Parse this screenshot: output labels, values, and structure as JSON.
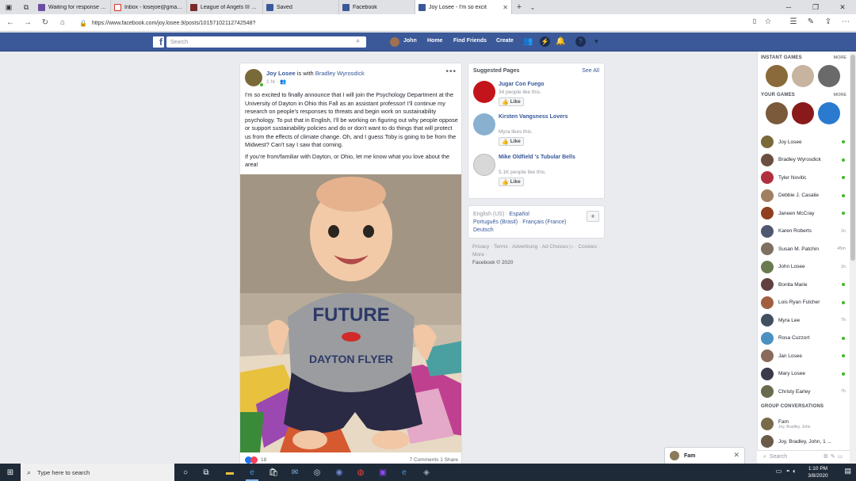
{
  "browser": {
    "tabs": [
      {
        "label": "Waiting for response from r",
        "color": "#6a4fa0"
      },
      {
        "label": "Inbox - losejoe@gmail.com",
        "color": "#d93025"
      },
      {
        "label": "League of Angels III on Face",
        "color": "#7a2a2a"
      },
      {
        "label": "Saved",
        "color": "#3b5998"
      },
      {
        "label": "Facebook",
        "color": "#3b5998"
      },
      {
        "label": "Joy Losee - I'm so excit",
        "color": "#3b5998"
      }
    ],
    "url": "https://www.facebook.com/joy.losee.9/posts/10157102112742548?"
  },
  "header": {
    "search_placeholder": "Search",
    "user": "John",
    "home": "Home",
    "find_friends": "Find Friends",
    "create": "Create"
  },
  "post": {
    "author": "Joy Losee",
    "with_text": "is with",
    "with_name": "Bradley Wyrosdick",
    "time": "1 hr · ",
    "body1": "I'm so excited to finally announce that I will join the Psychology Department at the University of Dayton in Ohio this Fall as an assistant professor! I'll continue my research on people's responses to threats and begin work on sustainability psychology. To put that in English, I'll be working on figuring out why people oppose or support sustainability policies and do or don't want to do things that will protect us from the effects of climate change. Oh, and I guess Toby is going to be from the Midwest? Can't say I saw that coming.",
    "body2": "If you're from/familiar with Dayton, or Ohio, let me know what you love about the area!",
    "shirt_line1": "FUTURE",
    "shirt_line2": "DAYTON FLYER",
    "reaction_count": "18",
    "comments": "7 Comments  1 Share"
  },
  "suggested": {
    "title": "Suggested Pages",
    "see_all": "See All",
    "like_label": "Like",
    "pages": [
      {
        "name": "Jugar Con Fuego",
        "likes": "34 people like this.",
        "color": "#c4141b"
      },
      {
        "name": "Kirsten Vangsness Lovers",
        "likes": "Myra likes this.",
        "color": "#8ab0d0"
      },
      {
        "name": "Mike Oldfield 's Tubular Bells",
        "likes": "5.1K people like this.",
        "color": "#d8d8d8"
      }
    ]
  },
  "languages": {
    "current": "English (US)",
    "sep": " · ",
    "l1": "Español",
    "l2": "Português (Brasil)",
    "l3": "Français (France)",
    "l4": "Deutsch"
  },
  "footer": {
    "links": "Privacy · Terms · Advertising · Ad Choices ▷ · Cookies · More ·",
    "copyright": "Facebook © 2020"
  },
  "chat": {
    "instant_games": "INSTANT GAMES",
    "your_games": "YOUR GAMES",
    "more": "MORE",
    "group_conv": "GROUP CONVERSATIONS",
    "search_placeholder": "Search",
    "contacts": [
      {
        "name": "Joy Losee",
        "status": "",
        "color": "#7a6a3a"
      },
      {
        "name": "Bradley Wyrosdick",
        "status": "",
        "color": "#6a5040"
      },
      {
        "name": "Tyler Novitic",
        "status": "",
        "color": "#b03040"
      },
      {
        "name": "Debbie J. Casalie",
        "status": "",
        "color": "#a08060"
      },
      {
        "name": "Janeen McCray",
        "status": "",
        "color": "#904020"
      },
      {
        "name": "Karen Roberts",
        "status": "1h",
        "color": "#505870"
      },
      {
        "name": "Susan M. Patchin",
        "status": "45m",
        "color": "#807060"
      },
      {
        "name": "John Losee",
        "status": "1h",
        "color": "#6a7a50"
      },
      {
        "name": "Bonita Marie",
        "status": "",
        "color": "#604040"
      },
      {
        "name": "Lois Ryan Fulcher",
        "status": "",
        "color": "#a06040"
      },
      {
        "name": "Myra Lee",
        "status": "7h",
        "color": "#405060"
      },
      {
        "name": "Rosa Cuzzort",
        "status": "",
        "color": "#4a90c0"
      },
      {
        "name": "Jan Losee",
        "status": "",
        "color": "#8a6a5a"
      },
      {
        "name": "Mary Losee",
        "status": "",
        "color": "#3a3a4a"
      },
      {
        "name": "Christy Earley",
        "status": "7h",
        "color": "#6a6a50"
      }
    ],
    "groups": [
      {
        "name": "Fam",
        "sub": "Joy, Bradley, John"
      },
      {
        "name": "Joy, Bradley, John, 1 ...",
        "sub": ""
      }
    ],
    "chat_tab": "Fam"
  },
  "taskbar": {
    "search": "Type here to search",
    "time": "1:10 PM",
    "date": "3/8/2020"
  }
}
